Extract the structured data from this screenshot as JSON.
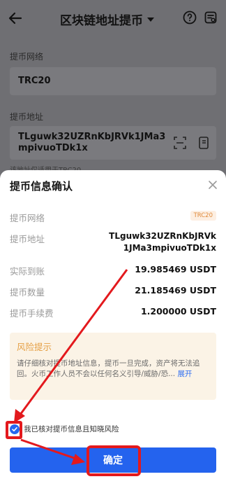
{
  "header": {
    "title": "区块链地址提币",
    "back_icon": "back-arrow-icon",
    "help_icon": "help-circle-icon",
    "record_icon": "record-icon"
  },
  "form": {
    "network_label": "提币网络",
    "network_value": "TRC20",
    "address_label": "提币地址",
    "address_value": "TLguwk32UZRnKbJRVk1JMa3mpivuoTDk1x",
    "address_hint": "该地址仅适用于TRC20"
  },
  "sheet": {
    "title": "提币信息确认",
    "rows": [
      {
        "label": "提币网络",
        "value": "TRC20"
      },
      {
        "label": "提币地址",
        "value": "TLguwk32UZRnKbJRVk1JMa3mpivuoTDk1x"
      },
      {
        "label": "实际到账",
        "value": "19.985469 USDT"
      },
      {
        "label": "提币数量",
        "value": "21.185469 USDT"
      },
      {
        "label": "提币手续费",
        "value": "1.200000 USDT"
      }
    ],
    "risk_title": "风险提示",
    "risk_text": "请仔细核对提币地址信息，提币一旦完成，资产将无法追回。火币工作人员不会以任何名义引导/威胁/恐...",
    "risk_more": "展开",
    "agree_text": "我已核对提币信息且知晓风险",
    "confirm_label": "确定"
  },
  "colors": {
    "primary": "#2463ee",
    "warning": "#e59f43",
    "annotation": "#e3191d"
  }
}
